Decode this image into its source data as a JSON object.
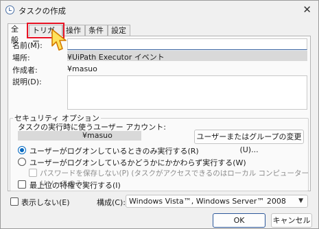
{
  "window": {
    "title": "タスクの作成",
    "close_glyph": "✕"
  },
  "tabs": [
    {
      "label": "全般",
      "active": true
    },
    {
      "label": "トリガー",
      "highlighted": true
    },
    {
      "label": "操作"
    },
    {
      "label": "条件"
    },
    {
      "label": "設定"
    }
  ],
  "general": {
    "name_label": "名前(M):",
    "location_label": "場所:",
    "location_value": "¥UiPath Executor イベント",
    "author_label": "作成者:",
    "author_value": "¥masuo",
    "description_label": "説明(D):"
  },
  "security": {
    "legend": "セキュリティ オプション",
    "account_prompt": "タスクの実行時に使うユーザー アカウント:",
    "account_value": "¥masuo",
    "change_user_button": "ユーザーまたはグループの変更(U)...",
    "radio_logged_on": "ユーザーがログオンしているときのみ実行する(R)",
    "radio_whether_logged_on": "ユーザーがログオンしているかどうかにかかわらず実行する(W)",
    "no_store_password": "パスワードを保存しない(P) (タスクがアクセスできるのはローカル コンピューター リソースのみ)",
    "highest_privileges": "最上位の特権で実行する(I)"
  },
  "footer": {
    "hidden_label": "表示しない(E)",
    "configure_label": "構成(C):",
    "configure_value": "Windows Vista™, Windows Server™ 2008",
    "ok_button": "OK",
    "cancel_button": "キャンセル"
  },
  "colors": {
    "highlight": "#e81123",
    "accent": "#0067c0",
    "cursor_fill": "#ffe25c"
  }
}
